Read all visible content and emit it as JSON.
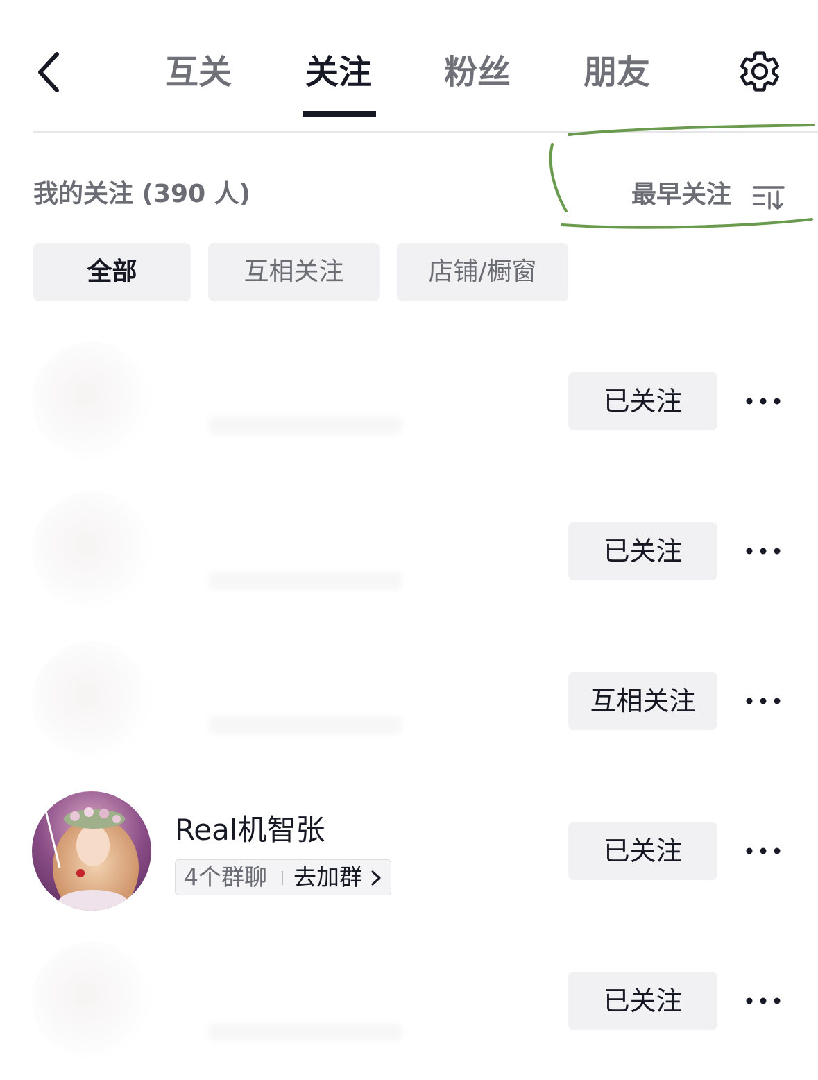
{
  "header": {
    "tabs": [
      {
        "label": "互关",
        "active": false
      },
      {
        "label": "关注",
        "active": true
      },
      {
        "label": "粉丝",
        "active": false
      },
      {
        "label": "朋友",
        "active": false
      }
    ],
    "back_icon": "chevron-left-icon",
    "settings_icon": "gear-icon"
  },
  "summary": {
    "title": "我的关注 (390 人)",
    "sort_label": "最早关注",
    "sort_icon": "sort-icon",
    "annotation_color": "#6a9a4e"
  },
  "filters": [
    {
      "label": "全部",
      "active": true
    },
    {
      "label": "互相关注",
      "active": false
    },
    {
      "label": "店铺/橱窗",
      "active": false
    }
  ],
  "list": [
    {
      "name": "",
      "status": "已关注",
      "blurred": true
    },
    {
      "name": "",
      "status": "已关注",
      "blurred": true
    },
    {
      "name": "",
      "status": "互相关注",
      "blurred": true
    },
    {
      "name": "Real机智张",
      "status": "已关注",
      "blurred": false,
      "group_count": "4个群聊",
      "group_action": "去加群"
    },
    {
      "name": "",
      "status": "已关注",
      "blurred": true
    }
  ],
  "more_icon": "more-dots-icon"
}
